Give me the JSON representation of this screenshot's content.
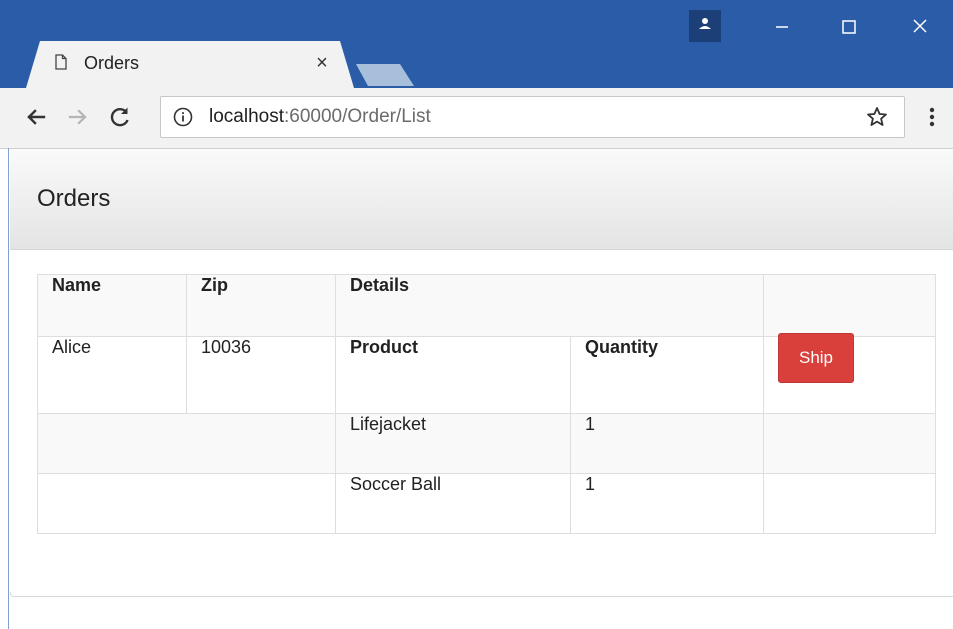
{
  "browser": {
    "tab": {
      "title": "Orders",
      "close_glyph": "×"
    },
    "address": {
      "host": "localhost",
      "path": ":60000/Order/List"
    },
    "icons": {
      "tab": "document-icon",
      "back": "arrow-left-icon",
      "forward": "arrow-right-icon",
      "reload": "reload-icon",
      "info": "info-icon",
      "bookmark": "star-icon",
      "menu": "kebab-menu-icon",
      "profile": "user-icon"
    },
    "colors": {
      "frame": "#2b5ca8",
      "toolbar": "#f2f2f2"
    }
  },
  "page": {
    "title": "Orders",
    "table": {
      "headers": [
        "Name",
        "Zip",
        "Details",
        ""
      ],
      "order": {
        "name": "Alice",
        "zip": "10036",
        "detail_headers": [
          "Product",
          "Quantity"
        ],
        "action_label": "Ship"
      },
      "lines": [
        {
          "product": "Lifejacket",
          "quantity": "1"
        },
        {
          "product": "Soccer Ball",
          "quantity": "1"
        }
      ]
    },
    "colors": {
      "ship_button": "#d9403b"
    }
  }
}
